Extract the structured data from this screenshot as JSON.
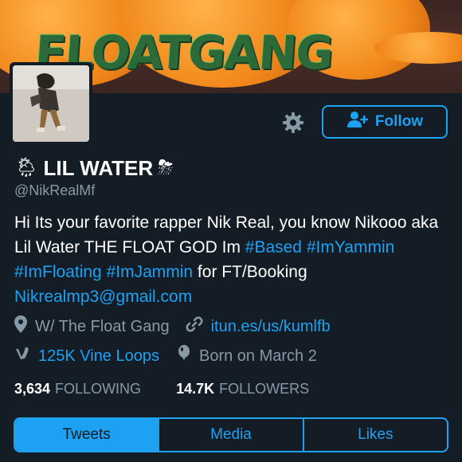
{
  "banner": {
    "logo_text": "FLOATGANG"
  },
  "profile": {
    "name": "LIL WATER",
    "name_prefix_emoji": "🌦",
    "name_suffix_emoji": "⛈",
    "handle": "@NikRealMf",
    "bio": {
      "text1": "Hi Its your favorite rapper Nik Real, you know Nikooo aka Lil Water THE FLOAT GOD Im ",
      "hashtag1": "#Based",
      "hashtag2": "#ImYammin",
      "hashtag3": "#ImFloating",
      "hashtag4": "#ImJammin",
      "text2": " for FT/Booking ",
      "email": "Nikrealmp3@gmail.com"
    },
    "location": "W/ The Float Gang",
    "website": "itun.es/us/kumlfb",
    "vine_loops": "125K Vine Loops",
    "birthday": "Born on March 2",
    "following_count": "3,634",
    "following_label": "FOLLOWING",
    "followers_count": "14.7K",
    "followers_label": "FOLLOWERS"
  },
  "actions": {
    "follow_label": "Follow"
  },
  "tabs": [
    {
      "label": "Tweets",
      "active": true
    },
    {
      "label": "Media",
      "active": false
    },
    {
      "label": "Likes",
      "active": false
    }
  ],
  "colors": {
    "background": "#141d26",
    "accent": "#1da1f2",
    "secondary_text": "#8899a6"
  },
  "icons": [
    "settings-gear-icon",
    "add-user-icon",
    "location-pin-icon",
    "link-icon",
    "vine-icon",
    "balloon-icon"
  ]
}
